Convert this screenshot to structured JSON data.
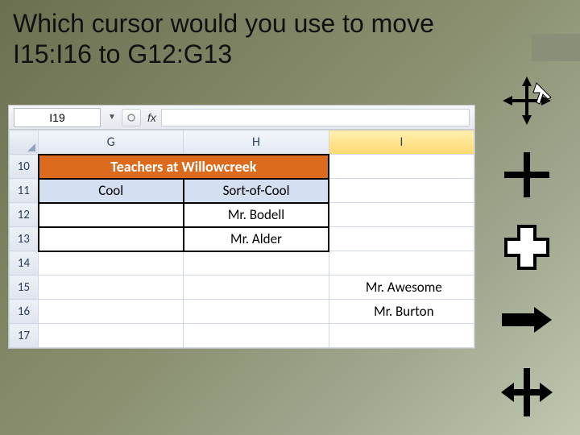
{
  "question": {
    "line1": "Which cursor would you use to move",
    "line2": "I15:I16 to G12:G13"
  },
  "excel": {
    "name_box": "I19",
    "fx_label": "fx",
    "columns": {
      "G": "G",
      "H": "H",
      "I": "I"
    },
    "rows": {
      "r10": "10",
      "r11": "11",
      "r12": "12",
      "r13": "13",
      "r14": "14",
      "r15": "15",
      "r16": "16",
      "r17": "17"
    },
    "cells": {
      "title": "Teachers at Willowcreek",
      "g11": "Cool",
      "h11": "Sort-of-Cool",
      "h12": "Mr. Bodell",
      "h13": "Mr. Alder",
      "i15": "Mr. Awesome",
      "i16": "Mr. Burton"
    }
  },
  "cursors": {
    "move": "move-cursor",
    "thin_plus": "precision-select-cursor",
    "fat_plus": "cell-select-cursor",
    "arrow_right": "right-arrow-cursor",
    "resize": "resize-cursor"
  }
}
